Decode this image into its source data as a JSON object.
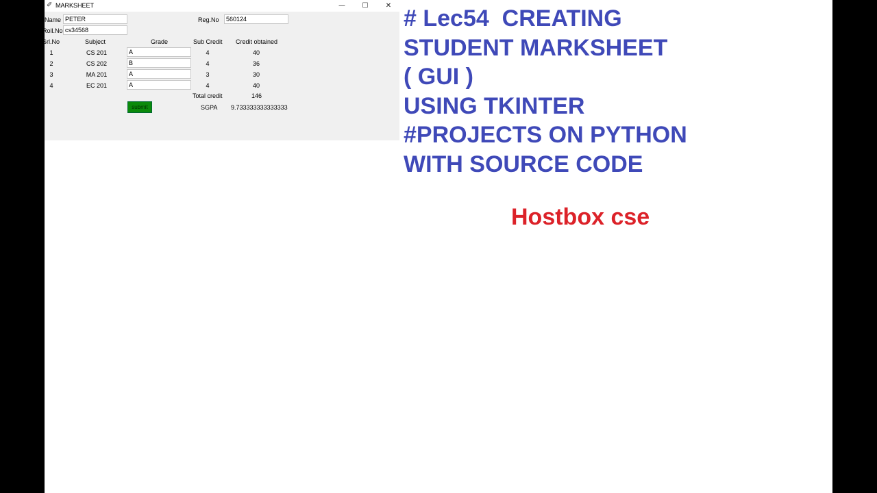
{
  "window": {
    "title": "MARKSHEET",
    "minimize": "—",
    "maximize": "☐",
    "close": "✕"
  },
  "form": {
    "name_label": "Name",
    "name_value": "PETER",
    "reg_label": "Reg.No",
    "reg_value": "560124",
    "roll_label": "Roll.No",
    "roll_value": "cs34568"
  },
  "table": {
    "headers": [
      "Srl.No",
      "Subject",
      "Grade",
      "Sub Credit",
      "Credit obtained"
    ],
    "rows": [
      {
        "srl": "1",
        "subject": "CS 201",
        "grade": "A",
        "credit": "4",
        "obtained": "40"
      },
      {
        "srl": "2",
        "subject": "CS 202",
        "grade": "B",
        "credit": "4",
        "obtained": "36"
      },
      {
        "srl": "3",
        "subject": "MA 201",
        "grade": "A",
        "credit": "3",
        "obtained": "30"
      },
      {
        "srl": "4",
        "subject": "EC 201",
        "grade": "A",
        "credit": "4",
        "obtained": "40"
      }
    ]
  },
  "summary": {
    "total_label": "Total credit",
    "total_value": "146",
    "sgpa_label": "SGPA",
    "sgpa_value": "9.733333333333333"
  },
  "submit_label": "submit",
  "overlay": {
    "lines": [
      "# Lec54  CREATING",
      "STUDENT MARKSHEET",
      "( GUI )",
      "USING TKINTER",
      "#PROJECTS ON PYTHON",
      "WITH SOURCE CODE"
    ],
    "brand": "Hostbox cse"
  },
  "colors": {
    "headline": "#3f49b8",
    "brand": "#dc2229",
    "submit_bg": "#0b8a0b",
    "window_bg": "#f0f0f0"
  }
}
